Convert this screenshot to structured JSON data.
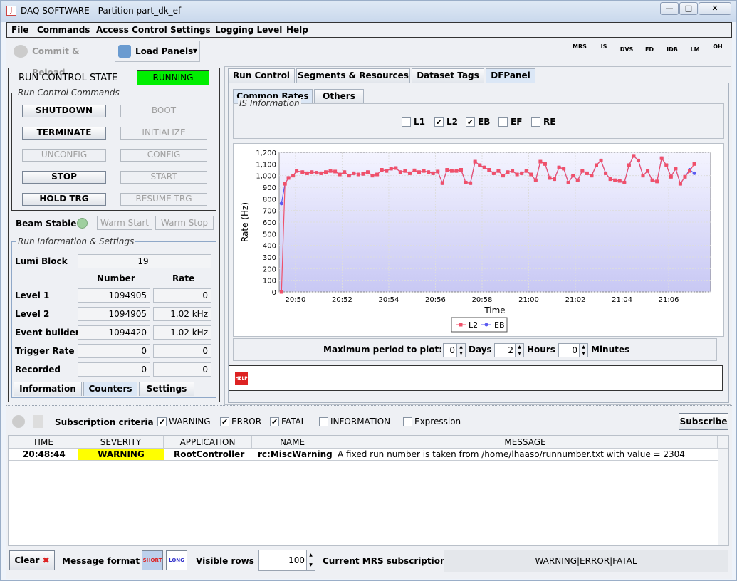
{
  "window": {
    "title": "DAQ SOFTWARE - Partition part_dk_ef",
    "min": "—",
    "max": "□",
    "close": "✕"
  },
  "menu": [
    "File",
    "Commands",
    "Access Control",
    "Settings",
    "Logging Level",
    "Help"
  ],
  "toolbar": {
    "commit": "Commit & Reload",
    "load": "Load Panels",
    "icons": [
      "MRS",
      "IS",
      "DVS",
      "ED",
      "IDB",
      "LM",
      "OH"
    ]
  },
  "rc": {
    "state_label": "RUN CONTROL STATE",
    "state": "RUNNING",
    "state_color": "#00ee00",
    "commands_title": "Run Control Commands",
    "left_buttons": [
      "SHUTDOWN",
      "TERMINATE",
      "UNCONFIG",
      "STOP",
      "HOLD TRG"
    ],
    "right_buttons": [
      "BOOT",
      "INITIALIZE",
      "CONFIG",
      "START",
      "RESUME TRG"
    ],
    "beam_stable": "Beam Stable",
    "warm_start": "Warm Start",
    "warm_stop": "Warm Stop",
    "info_title": "Run Information & Settings",
    "lumi_label": "Lumi Block",
    "lumi": "19",
    "col_number": "Number",
    "col_rate": "Rate",
    "rows": [
      [
        "Level 1",
        "1094905",
        "0"
      ],
      [
        "Level 2",
        "1094905",
        "1.02 kHz"
      ],
      [
        "Event builder",
        "1094420",
        "1.02 kHz"
      ],
      [
        "Trigger Rate",
        "0",
        "0"
      ],
      [
        "Recorded",
        "0",
        "0"
      ]
    ],
    "bottom_tabs": [
      "Information",
      "Counters",
      "Settings"
    ]
  },
  "tabs": [
    "Run Control",
    "Segments & Resources",
    "Dataset Tags",
    "DFPanel"
  ],
  "subtabs": [
    "Common Rates",
    "Others"
  ],
  "is_title": "IS Information",
  "levels": [
    {
      "l": "L1",
      "c": false
    },
    {
      "l": "L2",
      "c": true
    },
    {
      "l": "EB",
      "c": true
    },
    {
      "l": "EF",
      "c": false
    },
    {
      "l": "RE",
      "c": false
    }
  ],
  "period": {
    "label": "Maximum period to plot:",
    "days": "0",
    "days_l": "Days",
    "hours": "2",
    "hours_l": "Hours",
    "minutes": "0",
    "minutes_l": "Minutes"
  },
  "help": "HELP",
  "chart_data": {
    "type": "line",
    "xlabel": "Time",
    "ylabel": "Rate (Hz)",
    "ylim": [
      0,
      1200
    ],
    "xticks": [
      "20:50",
      "20:52",
      "20:54",
      "20:56",
      "20:58",
      "21:00",
      "21:02",
      "21:04",
      "21:06"
    ],
    "yticks": [
      "0",
      "100",
      "200",
      "300",
      "400",
      "500",
      "600",
      "700",
      "800",
      "900",
      "1,000",
      "1,100",
      "1,200"
    ],
    "legend": [
      "L2",
      "EB"
    ],
    "colors": [
      "#f0506a",
      "#5a5af0"
    ],
    "x_minutes_from_2050": [
      -0.6,
      -0.45,
      -0.3,
      -0.1,
      0.05,
      0.3,
      0.5,
      0.7,
      0.9,
      1.1,
      1.3,
      1.5,
      1.7,
      1.9,
      2.1,
      2.3,
      2.5,
      2.7,
      2.9,
      3.1,
      3.3,
      3.5,
      3.7,
      3.9,
      4.1,
      4.3,
      4.5,
      4.7,
      4.9,
      5.1,
      5.3,
      5.5,
      5.7,
      5.9,
      6.1,
      6.3,
      6.5,
      6.7,
      6.9,
      7.1,
      7.3,
      7.5,
      7.7,
      7.9,
      8.1,
      8.3,
      8.5,
      8.7,
      8.9,
      9.1,
      9.3,
      9.5,
      9.7,
      9.9,
      10.1,
      10.3,
      10.5,
      10.7,
      10.9,
      11.1,
      11.3,
      11.5,
      11.7,
      11.9,
      12.1,
      12.3,
      12.5,
      12.7,
      12.9,
      13.1,
      13.3,
      13.5,
      13.7,
      13.9,
      14.1,
      14.3,
      14.5,
      14.7,
      14.9,
      15.1,
      15.3,
      15.5,
      15.7,
      15.9,
      16.1,
      16.3,
      16.5,
      16.7,
      16.9,
      17.1
    ],
    "series": [
      {
        "name": "L2",
        "values": [
          0,
          930,
          980,
          1000,
          1040,
          1030,
          1020,
          1030,
          1025,
          1020,
          1030,
          1040,
          1035,
          1010,
          1030,
          1000,
          1020,
          1010,
          1015,
          1030,
          1000,
          1010,
          1050,
          1040,
          1060,
          1065,
          1030,
          1040,
          1020,
          1045,
          1030,
          1040,
          1030,
          1020,
          1035,
          935,
          1050,
          1040,
          1040,
          1050,
          940,
          935,
          1120,
          1090,
          1070,
          1050,
          1020,
          1040,
          1000,
          1030,
          1040,
          1010,
          1020,
          1040,
          1010,
          960,
          1120,
          1100,
          980,
          970,
          1070,
          1060,
          940,
          1000,
          960,
          1040,
          1020,
          1000,
          1090,
          1130,
          1020,
          970,
          960,
          955,
          940,
          1090,
          1170,
          1130,
          1000,
          1040,
          960,
          950,
          1150,
          1090,
          990,
          1060,
          930,
          990,
          1040,
          1100
        ]
      },
      {
        "name": "EB",
        "values": [
          760,
          930,
          980,
          1000,
          1040,
          1030,
          1020,
          1030,
          1025,
          1020,
          1030,
          1040,
          1035,
          1010,
          1030,
          1000,
          1020,
          1010,
          1015,
          1030,
          1000,
          1010,
          1050,
          1040,
          1060,
          1065,
          1030,
          1040,
          1020,
          1045,
          1030,
          1040,
          1030,
          1020,
          1035,
          935,
          1050,
          1040,
          1040,
          1050,
          940,
          935,
          1120,
          1090,
          1070,
          1050,
          1020,
          1040,
          1000,
          1030,
          1040,
          1010,
          1020,
          1040,
          1010,
          960,
          1120,
          1100,
          980,
          970,
          1070,
          1060,
          940,
          1000,
          960,
          1040,
          1020,
          1000,
          1090,
          1130,
          1020,
          970,
          960,
          955,
          940,
          1090,
          1170,
          1130,
          1000,
          1040,
          960,
          950,
          1150,
          1090,
          990,
          1060,
          930,
          990,
          1050,
          1020
        ]
      }
    ]
  },
  "bottom": {
    "subscription": "Subscription criteria",
    "filters": [
      {
        "l": "WARNING",
        "c": true
      },
      {
        "l": "ERROR",
        "c": true
      },
      {
        "l": "FATAL",
        "c": true
      },
      {
        "l": "INFORMATION",
        "c": false
      },
      {
        "l": "Expression",
        "c": false
      }
    ],
    "subscribe": "Subscribe",
    "cols": [
      "TIME",
      "SEVERITY",
      "APPLICATION",
      "NAME",
      "MESSAGE"
    ],
    "row": {
      "time": "20:48:44",
      "severity": "WARNING",
      "app": "RootController",
      "name": "rc:MiscWarning",
      "message": "A fixed run number is taken from /home/lhaaso/runnumber.txt with value = 2304"
    },
    "clear": "Clear",
    "format": "Message format",
    "short": "SHORT",
    "long": "LONG",
    "visible": "Visible rows",
    "rows": "100",
    "mrs": "Current MRS subscription",
    "mrs_value": "WARNING|ERROR|FATAL"
  }
}
